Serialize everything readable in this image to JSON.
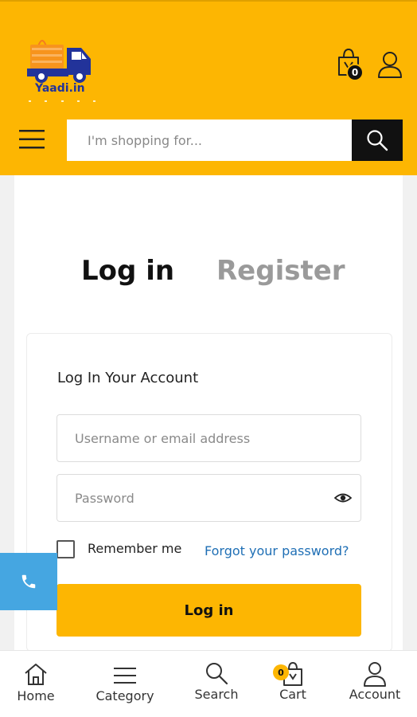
{
  "header": {
    "logo_text": "Yaadi.in",
    "cart_count": "0",
    "search": {
      "placeholder": "I'm shopping for..."
    }
  },
  "tabs": {
    "login": "Log in",
    "register": "Register"
  },
  "form": {
    "title": "Log In Your Account",
    "username_placeholder": "Username or email address",
    "password_placeholder": "Password",
    "remember_label": "Remember me",
    "forgot_link": "Forgot your password?",
    "submit_label": "Log in"
  },
  "bottom_nav": {
    "home": "Home",
    "category": "Category",
    "search": "Search",
    "cart": "Cart",
    "cart_count": "0",
    "account": "Account"
  },
  "icons": {
    "logo": "delivery-truck-logo",
    "cart": "shopping-bag-icon",
    "user": "user-icon",
    "menu": "hamburger-icon",
    "search": "search-icon",
    "eye": "eye-icon",
    "phone": "phone-icon",
    "home": "home-icon"
  },
  "colors": {
    "brand_yellow": "#fdb602",
    "search_button": "#111111",
    "link_blue": "#1f6fb5",
    "phone_blue": "#45a6e1",
    "logo_navy": "#22339a"
  }
}
